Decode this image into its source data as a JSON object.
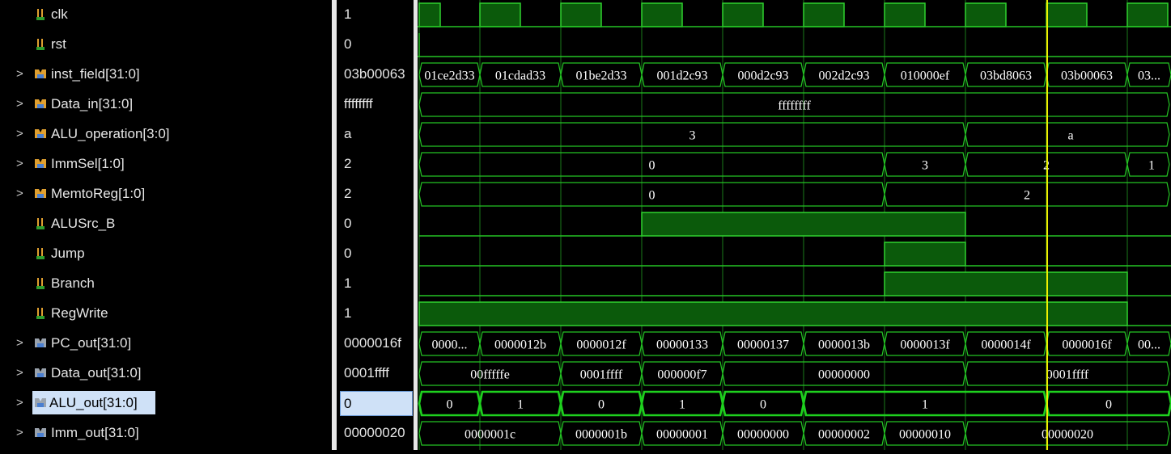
{
  "colors": {
    "wave_line": "#24c424",
    "wave_fill": "#0b5a0b",
    "wave_fill_border": "#2fd12f",
    "highlight_line": "#1ed11e",
    "cursor": "#f0f000",
    "selection": "#cfe1f7"
  },
  "signals": [
    {
      "name": "clk",
      "value": "1",
      "icon": "wire-icon",
      "expandable": false
    },
    {
      "name": "rst",
      "value": "0",
      "icon": "wire-icon",
      "expandable": false
    },
    {
      "name": "inst_field[31:0]",
      "value": "03b00063",
      "icon": "bus-icon",
      "expandable": true
    },
    {
      "name": "Data_in[31:0]",
      "value": "ffffffff",
      "icon": "bus-icon",
      "expandable": true
    },
    {
      "name": "ALU_operation[3:0]",
      "value": "a",
      "icon": "bus-icon",
      "expandable": true
    },
    {
      "name": "ImmSel[1:0]",
      "value": "2",
      "icon": "bus-icon",
      "expandable": true
    },
    {
      "name": "MemtoReg[1:0]",
      "value": "2",
      "icon": "bus-icon",
      "expandable": true
    },
    {
      "name": "ALUSrc_B",
      "value": "0",
      "icon": "wire-icon",
      "expandable": false
    },
    {
      "name": "Jump",
      "value": "0",
      "icon": "wire-icon",
      "expandable": false
    },
    {
      "name": "Branch",
      "value": "1",
      "icon": "wire-icon",
      "expandable": false
    },
    {
      "name": "RegWrite",
      "value": "1",
      "icon": "wire-icon",
      "expandable": false
    },
    {
      "name": "PC_out[31:0]",
      "value": "0000016f",
      "icon": "bus-out-icon",
      "expandable": true
    },
    {
      "name": "Data_out[31:0]",
      "value": "0001ffff",
      "icon": "bus-out-icon",
      "expandable": true
    },
    {
      "name": "ALU_out[31:0]",
      "value": "0",
      "icon": "bus-out-icon",
      "expandable": true,
      "selected": true
    },
    {
      "name": "Imm_out[31:0]",
      "value": "00000020",
      "icon": "bus-out-icon",
      "expandable": true
    }
  ],
  "waves": {
    "inst_field": [
      "01ce2d33",
      "01cdad33",
      "01be2d33",
      "001d2c93",
      "000d2c93",
      "002d2c93",
      "010000ef",
      "03bd8063",
      "03b00063",
      "03..."
    ],
    "Data_in": [
      "ffffffff"
    ],
    "ALU_operation": [
      "3",
      "a"
    ],
    "ImmSel": [
      "0",
      "3",
      "2",
      "1"
    ],
    "MemtoReg": [
      "0",
      "2"
    ],
    "PC_out": [
      "0000...",
      "0000012b",
      "0000012f",
      "00000133",
      "00000137",
      "0000013b",
      "0000013f",
      "0000014f",
      "0000016f",
      "00..."
    ],
    "Data_out": [
      "00fffffe",
      "0001ffff",
      "000000f7",
      "00000000",
      "0001ffff"
    ],
    "ALU_out": [
      "0",
      "1",
      "0",
      "1",
      "0",
      "1",
      "0"
    ],
    "Imm_out": [
      "0000001c",
      "0000001b",
      "00000001",
      "00000000",
      "00000002",
      "00000010",
      "00000020"
    ]
  }
}
